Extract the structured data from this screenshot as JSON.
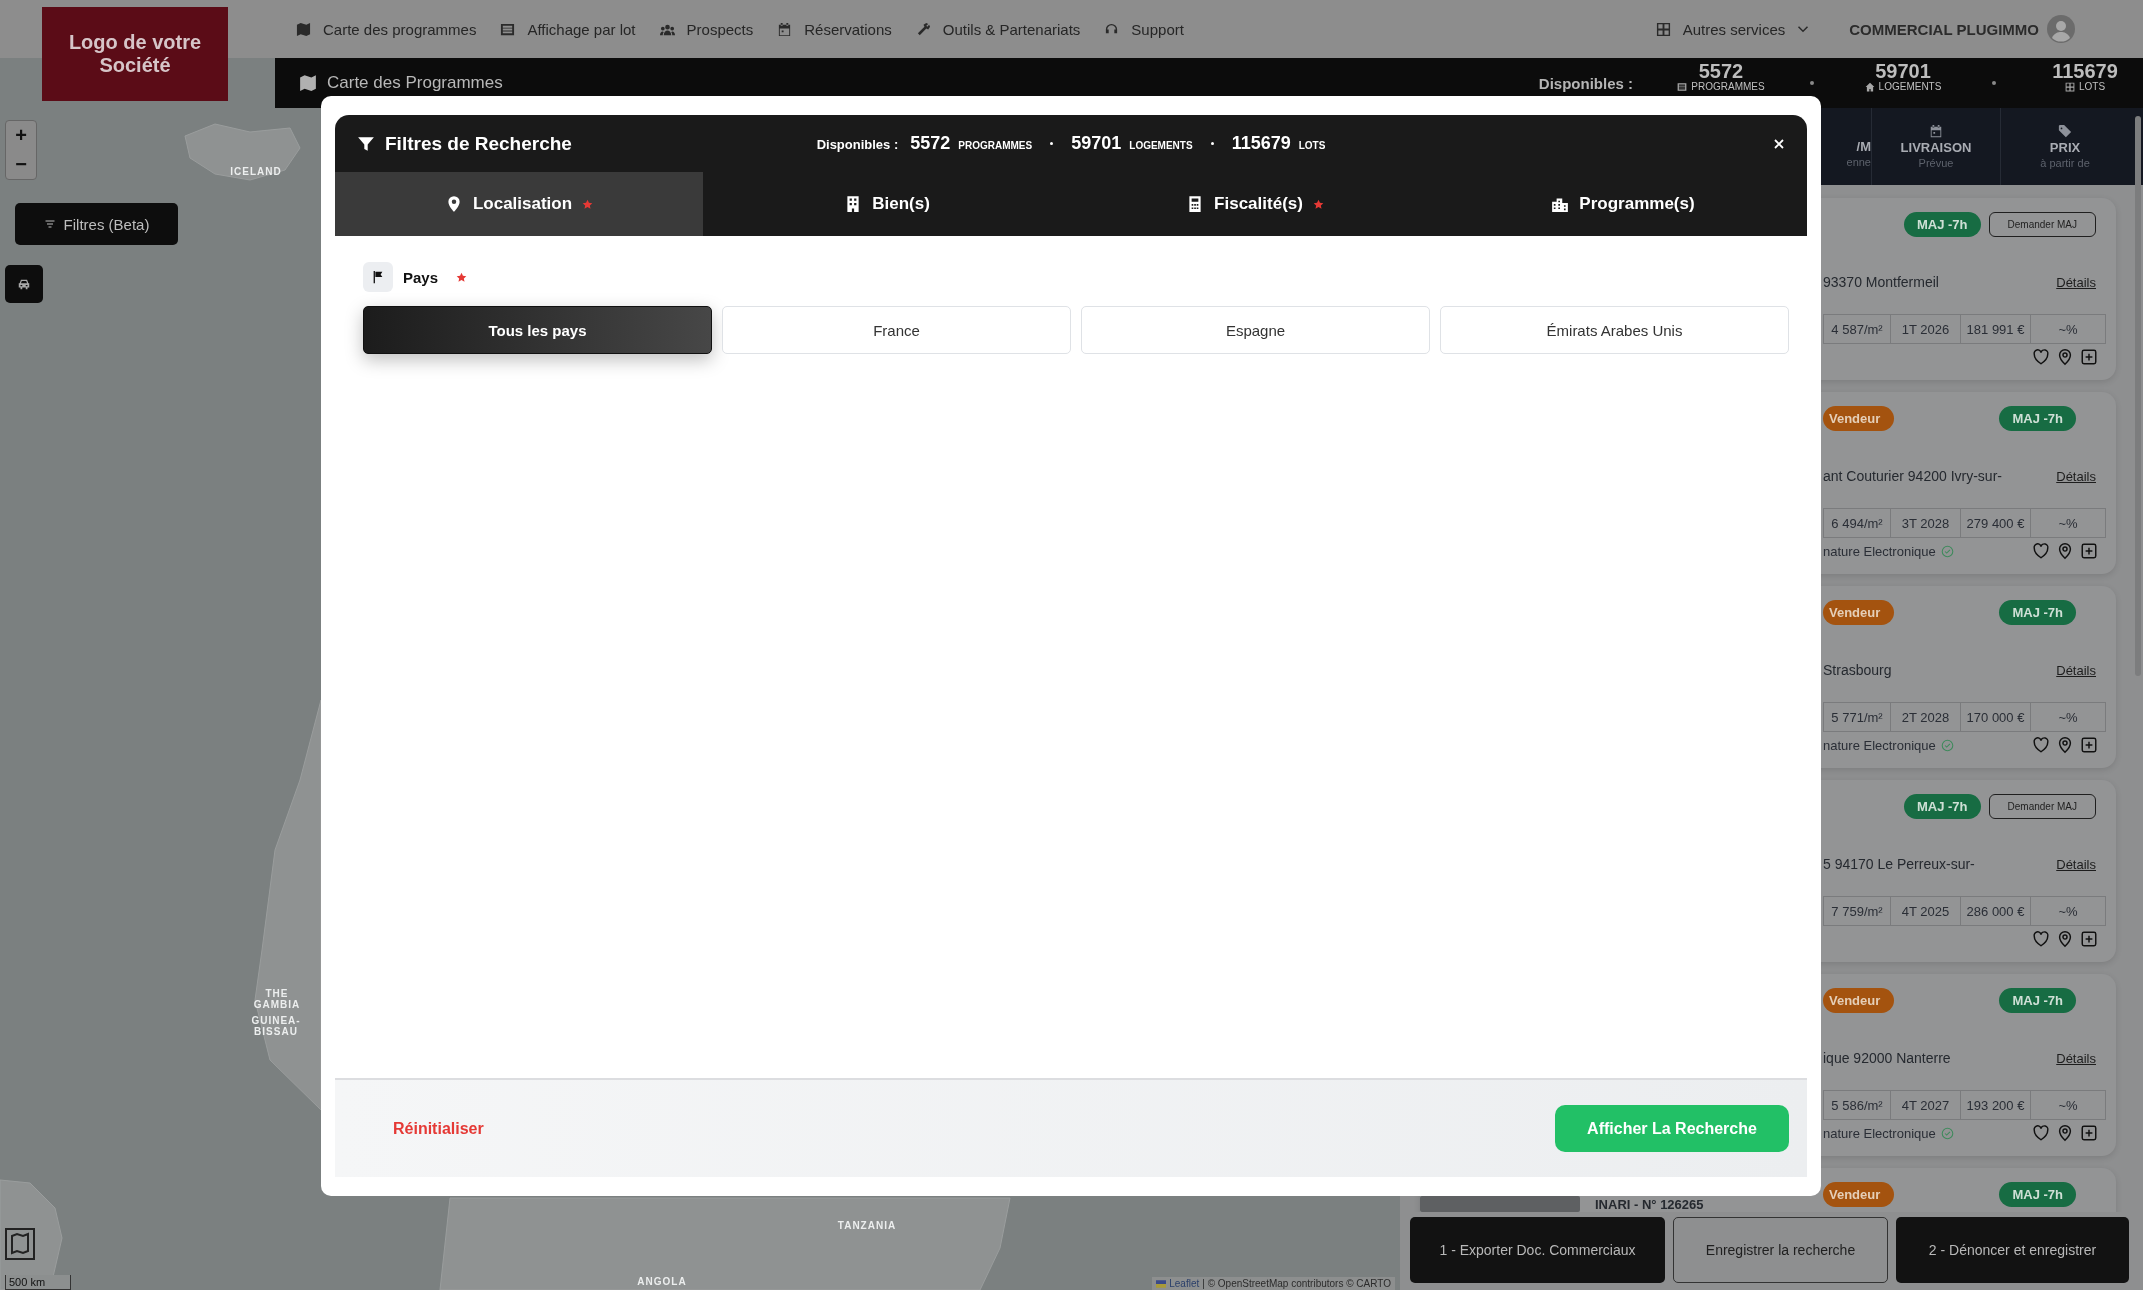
{
  "logo": "Logo de votre Société",
  "nav": {
    "items": [
      {
        "label": "Carte des programmes"
      },
      {
        "label": "Affichage par lot"
      },
      {
        "label": "Prospects"
      },
      {
        "label": "Réservations"
      },
      {
        "label": "Outils & Partenariats"
      },
      {
        "label": "Support"
      }
    ],
    "services": "Autres services",
    "user": "COMMERCIAL PLUGIMMO"
  },
  "title_bar": {
    "title": "Carte des Programmes",
    "available_label": "Disponibles :",
    "stats": [
      {
        "value": "5572",
        "unit": "PROGRAMMES"
      },
      {
        "value": "59701",
        "unit": "LOGEMENTS"
      },
      {
        "value": "115679",
        "unit": "LOTS"
      }
    ]
  },
  "map": {
    "zoom_in": "+",
    "zoom_out": "−",
    "filter_button": "Filtres (Beta)",
    "labels": [
      "ICELAND",
      "THE GAMBIA",
      "GUINEA-BISSAU",
      "TANZANIA",
      "ANGOLA"
    ],
    "scale": "500 km",
    "attribution_link": "Leaflet",
    "attribution": "| © OpenStreetMap contributors © CARTO"
  },
  "results_panel": {
    "columns": [
      {
        "title": "/M",
        "subtitle": "enne"
      },
      {
        "title": "LIVRAISON",
        "subtitle": "Prévue"
      },
      {
        "title": "PRIX",
        "subtitle": "à partir de"
      }
    ],
    "cards": [
      {
        "update_badge": "MAJ -7h",
        "request_button": "Demander MAJ",
        "address": "93370 Montfermeil",
        "details_link": "Détails",
        "cells": [
          "4 587/m²",
          "1T 2026",
          "181 991 €",
          "~%"
        ]
      },
      {
        "vendor_tag": "Vendeur",
        "update_badge": "MAJ -7h",
        "address": "ant Couturier 94200 Ivry-sur-",
        "details_link": "Détails",
        "cells": [
          "6 494/m²",
          "3T 2028",
          "279 400 €",
          "~%"
        ],
        "signature": "nature Electronique"
      },
      {
        "vendor_tag": "Vendeur",
        "update_badge": "MAJ -7h",
        "address": "Strasbourg",
        "details_link": "Détails",
        "cells": [
          "5 771/m²",
          "2T 2028",
          "170 000 €",
          "~%"
        ],
        "signature": "nature Electronique"
      },
      {
        "update_badge": "MAJ -7h",
        "request_button": "Demander MAJ",
        "address": "5 94170 Le Perreux-sur-",
        "details_link": "Détails",
        "cells": [
          "7 759/m²",
          "4T 2025",
          "286 000 €",
          "~%"
        ]
      },
      {
        "vendor_tag": "Vendeur",
        "update_badge": "MAJ -7h",
        "address": "ique 92000 Nanterre",
        "details_link": "Détails",
        "cells": [
          "5 586/m²",
          "4T 2027",
          "193 200 €",
          "~%"
        ],
        "signature": "nature Electronique"
      },
      {
        "vendor_tag": "Vendeur",
        "update_badge": "MAJ -7h",
        "program": "INARI - N° 126265"
      }
    ],
    "buttons": [
      {
        "label": "1 - Exporter Doc. Commerciaux",
        "kind": "dark"
      },
      {
        "label": "Enregistrer la recherche",
        "kind": "outline"
      },
      {
        "label": "2 - Dénoncer et enregistrer",
        "kind": "dark"
      }
    ]
  },
  "filter_dialog": {
    "title": "Filtres de Recherche",
    "available_label": "Disponibles :",
    "stats": [
      {
        "value": "5572",
        "unit": "PROGRAMMES"
      },
      {
        "value": "59701",
        "unit": "LOGEMENTS"
      },
      {
        "value": "115679",
        "unit": "LOTS"
      }
    ],
    "tabs": [
      {
        "label": "Localisation",
        "required": true,
        "selected": true
      },
      {
        "label": "Bien(s)",
        "required": false,
        "selected": false
      },
      {
        "label": "Fiscalité(s)",
        "required": true,
        "selected": false
      },
      {
        "label": "Programme(s)",
        "required": false,
        "selected": false
      }
    ],
    "field": {
      "label": "Pays",
      "required": true,
      "options": [
        {
          "label": "Tous les pays",
          "selected": true
        },
        {
          "label": "France",
          "selected": false
        },
        {
          "label": "Espagne",
          "selected": false
        },
        {
          "label": "Émirats Arabes Unis",
          "selected": false
        }
      ]
    },
    "reset": "Réinitialiser",
    "submit": "Afficher La Recherche"
  }
}
